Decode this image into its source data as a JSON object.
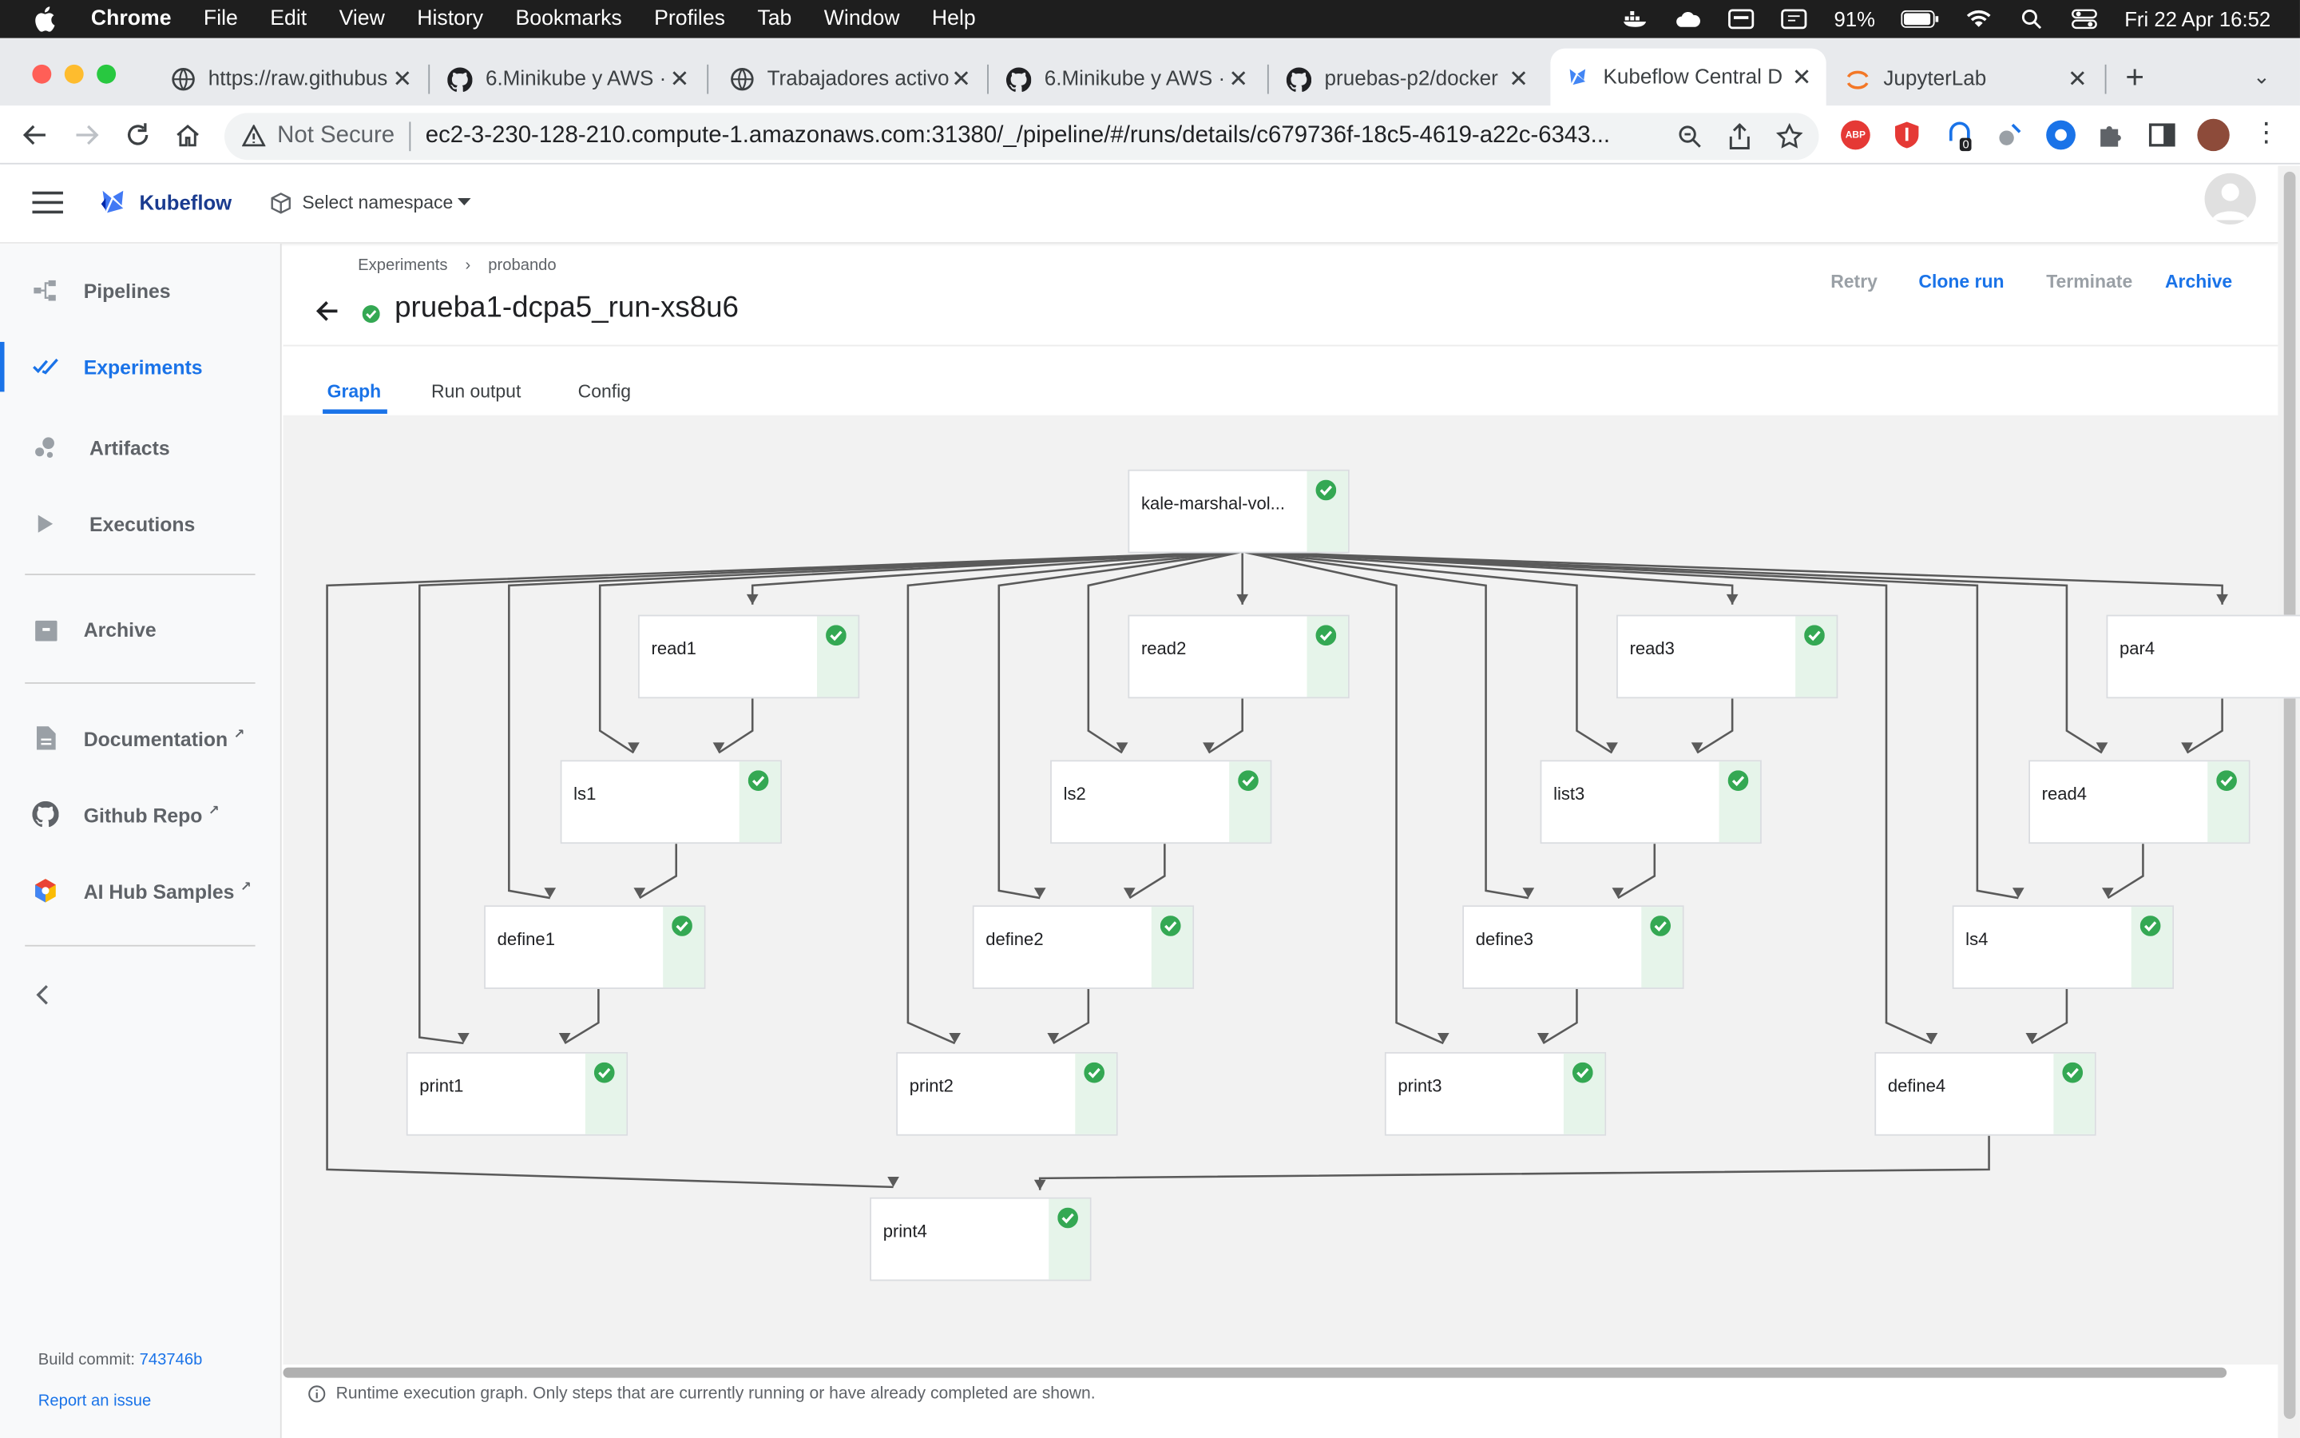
{
  "menubar": {
    "app": "Chrome",
    "items": [
      "File",
      "Edit",
      "View",
      "History",
      "Bookmarks",
      "Profiles",
      "Tab",
      "Window",
      "Help"
    ],
    "battery": "91%",
    "datetime": "Fri 22 Apr  16:52"
  },
  "tabs": [
    {
      "title": "https://raw.githubus",
      "icon": "globe-icon"
    },
    {
      "title": "6.Minikube y AWS ·",
      "icon": "github-icon"
    },
    {
      "title": "Trabajadores activo",
      "icon": "globe-icon"
    },
    {
      "title": "6.Minikube y AWS ·",
      "icon": "github-icon"
    },
    {
      "title": "pruebas-p2/docker",
      "icon": "github-icon"
    },
    {
      "title": "Kubeflow Central D",
      "icon": "kubeflow-icon"
    },
    {
      "title": "JupyterLab",
      "icon": "jupyter-icon"
    }
  ],
  "address": {
    "security": "Not Secure",
    "url": "ec2-3-230-128-210.compute-1.amazonaws.com:31380/_/pipeline/#/runs/details/c679736f-18c5-4619-a22c-6343..."
  },
  "extensions": {
    "badge": "0",
    "abp": "ABP"
  },
  "kf": {
    "brand": "Kubeflow",
    "namespace": "Select namespace"
  },
  "sidebar": {
    "items": [
      {
        "label": "Pipelines"
      },
      {
        "label": "Experiments"
      },
      {
        "label": "Artifacts"
      },
      {
        "label": "Executions"
      },
      {
        "label": "Archive"
      },
      {
        "label": "Documentation"
      },
      {
        "label": "Github Repo"
      },
      {
        "label": "AI Hub Samples"
      }
    ],
    "build_label": "Build commit:",
    "build_commit": "743746b",
    "report": "Report an issue"
  },
  "run": {
    "breadcrumb": [
      "Experiments",
      "probando"
    ],
    "title": "prueba1-dcpa5_run-xs8u6",
    "actions": {
      "retry": "Retry",
      "clone": "Clone run",
      "terminate": "Terminate",
      "archive": "Archive"
    },
    "tabs": [
      "Graph",
      "Run output",
      "Config"
    ]
  },
  "graph": {
    "nodes": [
      {
        "label": "kale-marshal-vol...",
        "status": "succeeded"
      },
      {
        "label": "read1",
        "status": "succeeded"
      },
      {
        "label": "read2",
        "status": "succeeded"
      },
      {
        "label": "read3",
        "status": "succeeded"
      },
      {
        "label": "par4",
        "status": "unknown"
      },
      {
        "label": "ls1",
        "status": "succeeded"
      },
      {
        "label": "ls2",
        "status": "succeeded"
      },
      {
        "label": "list3",
        "status": "succeeded"
      },
      {
        "label": "read4",
        "status": "succeeded"
      },
      {
        "label": "define1",
        "status": "succeeded"
      },
      {
        "label": "define2",
        "status": "succeeded"
      },
      {
        "label": "define3",
        "status": "succeeded"
      },
      {
        "label": "ls4",
        "status": "succeeded"
      },
      {
        "label": "print1",
        "status": "succeeded"
      },
      {
        "label": "print2",
        "status": "succeeded"
      },
      {
        "label": "print3",
        "status": "succeeded"
      },
      {
        "label": "define4",
        "status": "succeeded"
      },
      {
        "label": "print4",
        "status": "succeeded"
      }
    ],
    "footer": "Runtime execution graph. Only steps that are currently running or have already completed are shown."
  },
  "colors": {
    "accent": "#1a73e8",
    "success": "#34a853",
    "success_bg": "#e6f4ea"
  }
}
